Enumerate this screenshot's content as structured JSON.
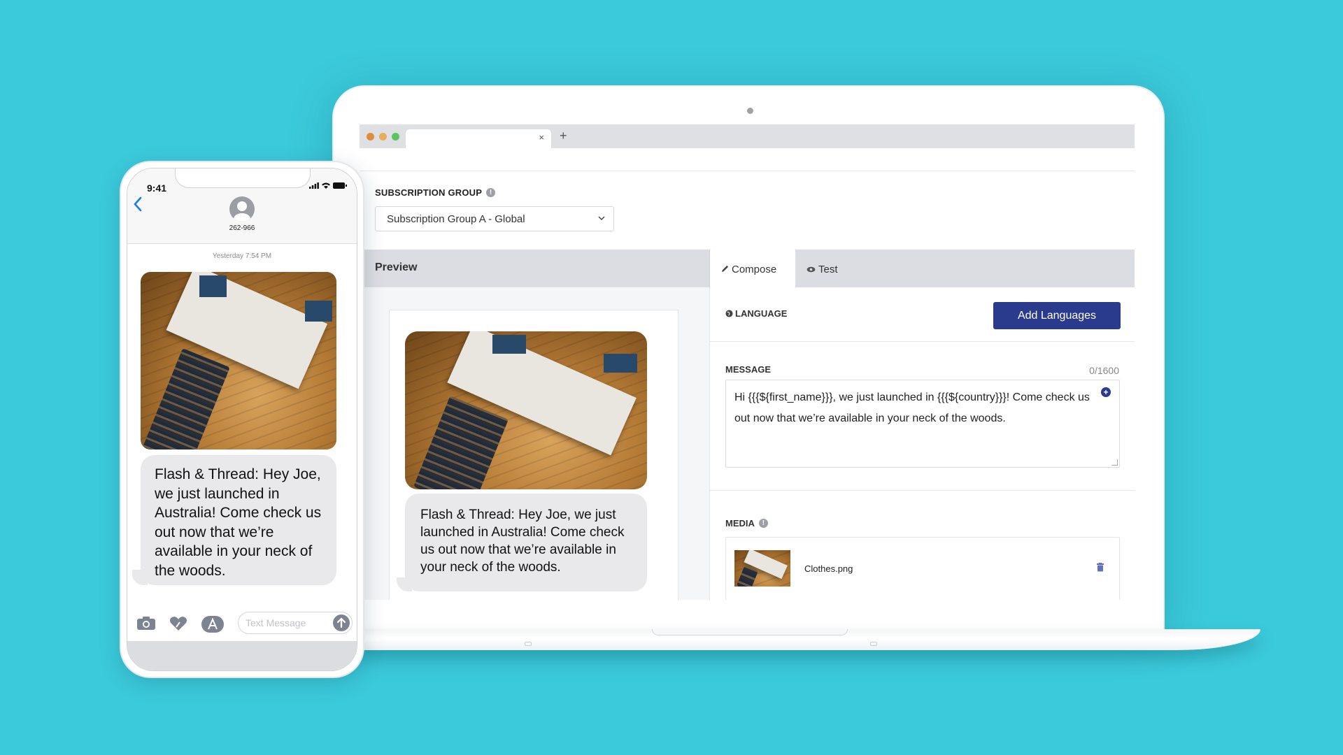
{
  "browser": {
    "tab_close": "×",
    "new_tab": "+",
    "traffic_lights": [
      "#e08c3a",
      "#e9ac5c",
      "#5cc45e"
    ]
  },
  "subscription": {
    "label": "SUBSCRIPTION GROUP",
    "info_icon": "!",
    "selected": "Subscription Group A - Global",
    "chevron": "⌄"
  },
  "preview": {
    "title": "Preview",
    "message": "Flash & Thread: Hey Joe, we just launched in Australia! Come check us out now that we’re available in your neck of the woods."
  },
  "compose": {
    "tabs": [
      {
        "label": "Compose",
        "icon": "pencil-icon",
        "active": true
      },
      {
        "label": "Test",
        "icon": "eye-icon",
        "active": false
      }
    ],
    "language_label": "LANGUAGE",
    "add_languages_button": "Add Languages",
    "message_label": "MESSAGE",
    "char_count": "0/1600",
    "message_text": "Hi {{{${first_name}}}, we just launched in {{{${country}}}! Come check us out now that we’re available in your neck of the woods.",
    "plus_icon": "+",
    "media_label": "MEDIA",
    "media_file": "Clothes.png"
  },
  "phone": {
    "time": "9:41",
    "contact": "262-966",
    "timestamp": "Yesterday 7:54 PM",
    "message": "Flash & Thread: Hey Joe, we just launched in Australia! Come check us out now that we’re available in your neck of the woods.",
    "input_placeholder": "Text Message"
  },
  "colors": {
    "background": "#3bcadb",
    "accent_button": "#2a3a8c",
    "bubble": "#e9e9eb",
    "ios_blue": "#1a7cf3"
  }
}
